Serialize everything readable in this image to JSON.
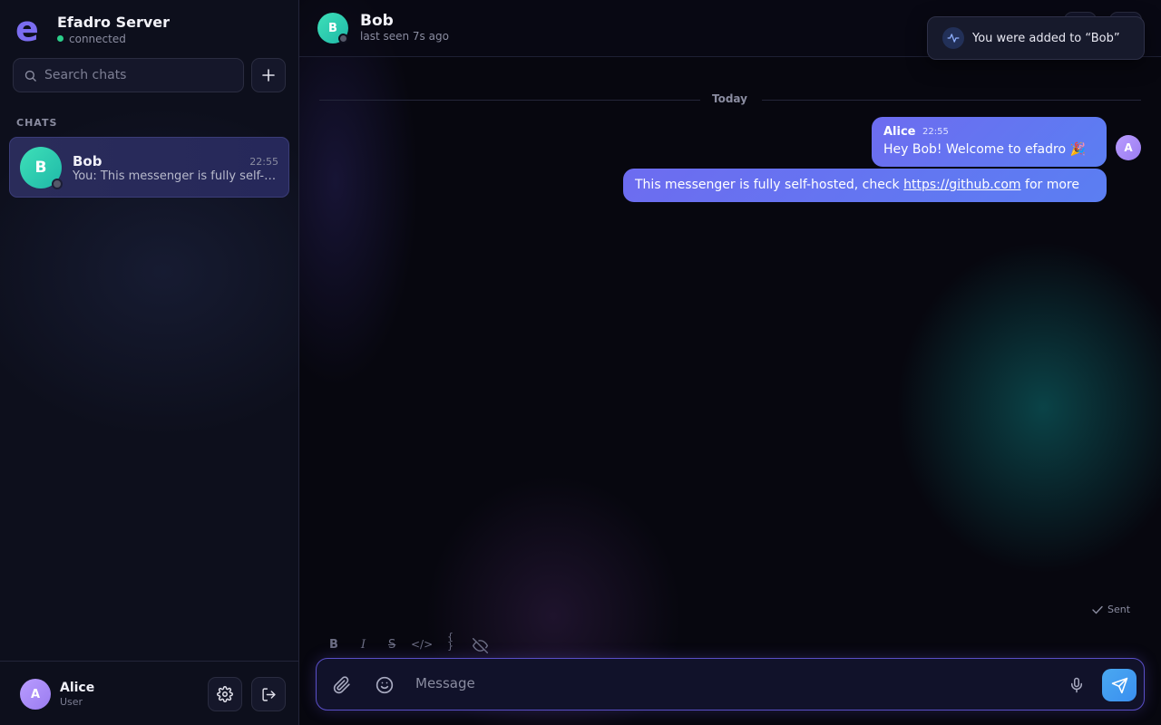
{
  "brand": {
    "title": "Efadro Server",
    "status": "connected",
    "logo_letter": "e"
  },
  "search": {
    "placeholder": "Search chats",
    "icon": "search-icon"
  },
  "sidebar": {
    "section_label": "CHATS",
    "chats": [
      {
        "initial": "B",
        "name": "Bob",
        "time": "22:55",
        "preview": "You: This messenger is fully self-hosted, check https://github.com for more"
      }
    ]
  },
  "current_user": {
    "initial": "A",
    "name": "Alice",
    "role": "User"
  },
  "header": {
    "initial": "B",
    "name": "Bob",
    "status": "last seen 7s ago"
  },
  "toast": {
    "text": "You were added to “Bob”",
    "icon": "activity-icon"
  },
  "conversation": {
    "date_divider": "Today",
    "messages": [
      {
        "author": "Alice",
        "time": "22:55",
        "text": "Hey Bob! Welcome to efadro 🎉",
        "author_initial": "A"
      },
      {
        "text_before": "This messenger is fully self-hosted, check ",
        "link": "https://github.com",
        "text_after": " for more"
      }
    ],
    "delivery_status": "Sent"
  },
  "formatting": {
    "bold": "B",
    "italic": "I",
    "strike": "S",
    "code": "</>",
    "block": "{ }"
  },
  "composer": {
    "placeholder": "Message"
  },
  "colors": {
    "accent": "#6d6cf0",
    "bob_avatar": "#2dcfb0",
    "alice_avatar": "#a98cf8",
    "online": "#2bcf8a"
  }
}
